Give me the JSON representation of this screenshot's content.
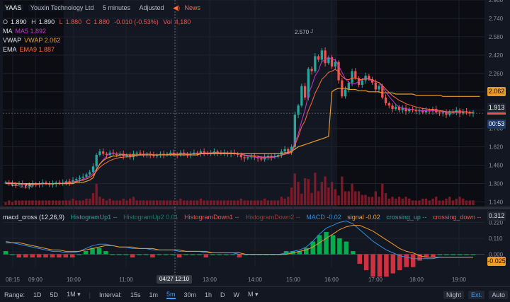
{
  "header": {
    "symbol": "YAAS",
    "company": "Youxin Technology Ltd",
    "interval": "5 minutes",
    "adjusted": "Adjusted",
    "news": "News",
    "ohlc": {
      "o_label": "O",
      "o": "1.890",
      "h_label": "H",
      "h": "1.890",
      "l_label": "L",
      "l": "1.880",
      "c_label": "C",
      "c": "1.880",
      "change": "-0.010 (-0.53%)",
      "vol_label": "Vol",
      "vol": "4,180"
    },
    "ma": {
      "label": "MA",
      "value": "MA5 1.892"
    },
    "vwap": {
      "label": "VWAP",
      "value": "VWAP 2.062"
    },
    "ema": {
      "label": "EMA",
      "value": "EMA9 1.887"
    }
  },
  "annotations": {
    "high": "2.570",
    "low": "1.230"
  },
  "price_tags": {
    "vwap": "2.062",
    "last": "1.913",
    "countdown": "00:53"
  },
  "macd_tags": {
    "hist": "0.312",
    "macd": "-0.025"
  },
  "colors": {
    "up": "#26a69a",
    "down": "#ef5350",
    "bull": "#00c853",
    "bear": "#f23645",
    "ma": "#c038c8",
    "vwap": "#e89a2c",
    "ema": "#ff6b3d",
    "macd": "#2f8fe0",
    "signal": "#f39b2a",
    "volume": "#8a1a2a",
    "bg": "#131722",
    "night": "#0b0d13"
  },
  "chart_data": {
    "type": "candlestick",
    "price_axis": {
      "ticks": [
        2.9,
        2.74,
        2.58,
        2.42,
        2.26,
        2.1,
        1.94,
        1.78,
        1.62,
        1.46,
        1.3,
        1.14
      ],
      "labels": [
        "2.900",
        "2.740",
        "2.580",
        "2.420",
        "2.260",
        "2.100",
        "1.940",
        "1.780",
        "1.620",
        "1.460",
        "1.300",
        "1.140"
      ],
      "ylim": [
        1.1,
        2.9
      ]
    },
    "time_axis": {
      "labels": [
        "08:15",
        "09:00",
        "10:00",
        "11:00",
        "12:00",
        "13:00",
        "14:00",
        "15:00",
        "16:00",
        "17:00",
        "18:00",
        "19:00"
      ],
      "crosshair_label": "04/27 12:10"
    },
    "closes": [
      1.31,
      1.3,
      1.3,
      1.29,
      1.3,
      1.29,
      1.28,
      1.29,
      1.3,
      1.29,
      1.3,
      1.31,
      1.3,
      1.29,
      1.3,
      1.31,
      1.3,
      1.31,
      1.32,
      1.31,
      1.33,
      1.34,
      1.35,
      1.36,
      1.38,
      1.4,
      1.45,
      1.55,
      1.58,
      1.56,
      1.55,
      1.57,
      1.56,
      1.55,
      1.56,
      1.54,
      1.55,
      1.53,
      1.56,
      1.57,
      1.56,
      1.55,
      1.56,
      1.55,
      1.54,
      1.55,
      1.56,
      1.55,
      1.56,
      1.57,
      1.56,
      1.55,
      1.57,
      1.56,
      1.55,
      1.56,
      1.57,
      1.56,
      1.58,
      1.57,
      1.56,
      1.57,
      1.58,
      1.57,
      1.56,
      1.57,
      1.56,
      1.57,
      1.56,
      1.55,
      1.53,
      1.52,
      1.53,
      1.54,
      1.53,
      1.52,
      1.51,
      1.53,
      1.54,
      1.53,
      1.54,
      1.55,
      1.58,
      1.6,
      1.57,
      1.62,
      1.9,
      1.98,
      2.15,
      2.05,
      2.3,
      2.28,
      2.41,
      2.38,
      2.46,
      2.35,
      2.4,
      2.32,
      2.36,
      2.2,
      2.06,
      2.12,
      2.18,
      2.28,
      2.22,
      2.16,
      2.2,
      2.24,
      2.21,
      2.18,
      2.12,
      2.15,
      2.05,
      2.0,
      1.98,
      1.95,
      1.97,
      1.94,
      1.96,
      1.93,
      1.95,
      1.94,
      1.93,
      1.94,
      1.92,
      1.94,
      1.93,
      1.95,
      1.92,
      1.91,
      1.92,
      1.9,
      1.93,
      1.92,
      1.94,
      1.91,
      1.93,
      1.92,
      1.91,
      1.92
    ],
    "vwap": [
      1.3,
      1.3,
      1.3,
      1.3,
      1.3,
      1.3,
      1.3,
      1.3,
      1.3,
      1.3,
      1.3,
      1.3,
      1.3,
      1.3,
      1.3,
      1.3,
      1.3,
      1.3,
      1.3,
      1.3,
      1.3,
      1.31,
      1.31,
      1.31,
      1.32,
      1.33,
      1.35,
      1.42,
      1.47,
      1.5,
      1.52,
      1.53,
      1.54,
      1.54,
      1.55,
      1.55,
      1.55,
      1.55,
      1.55,
      1.55,
      1.55,
      1.55,
      1.55,
      1.55,
      1.55,
      1.55,
      1.55,
      1.55,
      1.55,
      1.55,
      1.55,
      1.55,
      1.55,
      1.55,
      1.55,
      1.55,
      1.55,
      1.55,
      1.56,
      1.56,
      1.56,
      1.56,
      1.56,
      1.56,
      1.56,
      1.56,
      1.56,
      1.56,
      1.56,
      1.56,
      1.56,
      1.56,
      1.56,
      1.56,
      1.56,
      1.56,
      1.56,
      1.56,
      1.56,
      1.56,
      1.56,
      1.56,
      1.56,
      1.57,
      1.57,
      1.58,
      1.6,
      1.62,
      1.63,
      1.64,
      1.65,
      1.66,
      1.67,
      1.68,
      1.69,
      1.7,
      1.71,
      2.1,
      2.12,
      2.13,
      2.13,
      2.13,
      2.12,
      2.12,
      2.12,
      2.11,
      2.11,
      2.11,
      2.1,
      2.1,
      2.1,
      2.1,
      2.09,
      2.09,
      2.09,
      2.09,
      2.08,
      2.08,
      2.08,
      2.08,
      2.08,
      2.08,
      2.07,
      2.07,
      2.07,
      2.07,
      2.07,
      2.07,
      2.07,
      2.07,
      2.06,
      2.06,
      2.06,
      2.06,
      2.06,
      2.06,
      2.06,
      2.06,
      2.06,
      2.06,
      2.06,
      2.06
    ],
    "macd_axis": {
      "ticks": [
        0.22,
        0.11,
        0.0
      ],
      "labels": [
        "0.220",
        "0.110",
        "0.000"
      ],
      "ylim": [
        -0.09,
        0.31
      ]
    },
    "macd": [
      0.09,
      0.08,
      0.07,
      0.06,
      0.05,
      0.04,
      0.03,
      0.02,
      0.02,
      0.01,
      0.01,
      0.02,
      0.04,
      0.06,
      0.07,
      0.07,
      0.06,
      0.05,
      0.05,
      0.04,
      0.04,
      0.04,
      0.03,
      0.03,
      0.03,
      0.03,
      0.02,
      0.02,
      0.02,
      0.02,
      0.01,
      0.01,
      0.01,
      0.01,
      0.01,
      0.0,
      0.0,
      0.0,
      0.0,
      0.0,
      0.0,
      0.0,
      0.01,
      0.02,
      0.03,
      0.05,
      0.09,
      0.14,
      0.18,
      0.2,
      0.22,
      0.23,
      0.21,
      0.17,
      0.13,
      0.09,
      0.06,
      0.03,
      0.01,
      -0.01,
      -0.02,
      -0.03,
      -0.03,
      -0.03,
      -0.03,
      -0.02,
      -0.02,
      -0.02,
      -0.02,
      -0.02,
      -0.02
    ],
    "signal": [
      0.08,
      0.08,
      0.08,
      0.07,
      0.06,
      0.05,
      0.04,
      0.03,
      0.03,
      0.02,
      0.02,
      0.02,
      0.03,
      0.04,
      0.05,
      0.06,
      0.06,
      0.05,
      0.05,
      0.05,
      0.04,
      0.04,
      0.04,
      0.03,
      0.03,
      0.03,
      0.03,
      0.02,
      0.02,
      0.02,
      0.02,
      0.01,
      0.01,
      0.01,
      0.01,
      0.01,
      0.0,
      0.0,
      0.0,
      0.0,
      0.0,
      0.0,
      0.0,
      0.01,
      0.02,
      0.03,
      0.05,
      0.08,
      0.11,
      0.14,
      0.17,
      0.19,
      0.2,
      0.2,
      0.18,
      0.16,
      0.13,
      0.1,
      0.07,
      0.04,
      0.02,
      0.01,
      -0.01,
      -0.02,
      -0.02,
      -0.02,
      -0.02,
      -0.02,
      -0.02,
      -0.02,
      -0.02
    ],
    "series": [
      {
        "name": "MA5",
        "values": []
      },
      {
        "name": "VWAP",
        "values": []
      },
      {
        "name": "EMA9",
        "values": []
      },
      {
        "name": "MACD",
        "values": []
      },
      {
        "name": "signal",
        "values": []
      }
    ]
  },
  "macd_legend": {
    "title": "macd_cross (12,26,9)",
    "hist_up1": "HistogramUp1 --",
    "hist_up2": "HistogramUp2 0.01",
    "hist_down1": "HistogramDown1 --",
    "hist_down2": "HistogramDown2 --",
    "macd": "MACD -0.02",
    "signal": "signal -0.02",
    "cross_up": "crossing_up --",
    "cross_down": "crossing_down --"
  },
  "toolbar": {
    "range_label": "Range:",
    "ranges": [
      "1D",
      "5D",
      "1M ▾"
    ],
    "interval_label": "Interval:",
    "intervals": [
      "15s",
      "1m",
      "5m",
      "30m",
      "1h",
      "D",
      "W",
      "M ▾"
    ],
    "selected_interval": "5m",
    "night": "Night",
    "ext": "Ext.",
    "auto": "Auto"
  }
}
